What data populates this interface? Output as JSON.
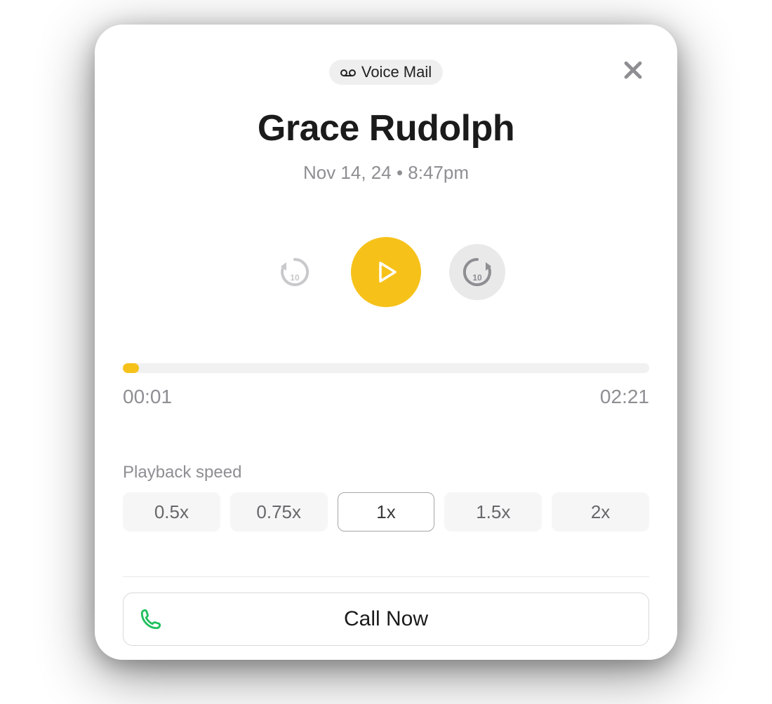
{
  "badge": {
    "label": "Voice Mail"
  },
  "header": {
    "name": "Grace Rudolph",
    "date": "Nov 14, 24",
    "time": "8:47pm"
  },
  "player": {
    "current": "00:01",
    "duration": "02:21",
    "skip_seconds": "10"
  },
  "speed": {
    "label": "Playback speed",
    "options": [
      "0.5x",
      "0.75x",
      "1x",
      "1.5x",
      "2x"
    ],
    "selected_index": 2
  },
  "actions": {
    "call": "Call Now"
  },
  "colors": {
    "accent": "#f6c21a",
    "phone_icon": "#1fbf5b"
  }
}
